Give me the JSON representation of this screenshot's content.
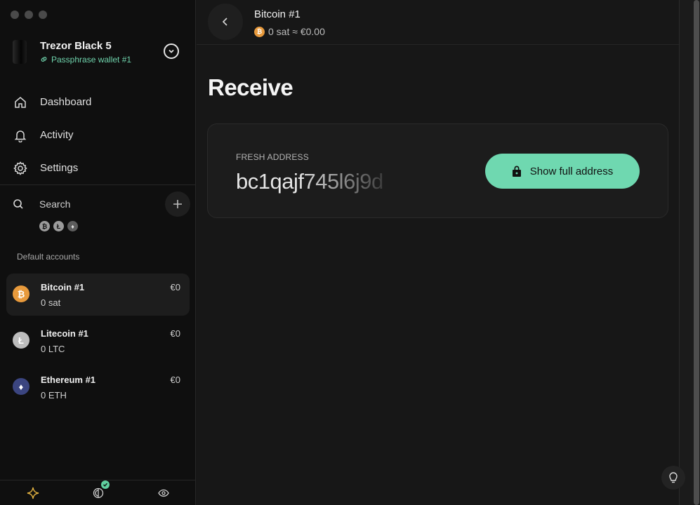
{
  "device": {
    "name": "Trezor Black 5",
    "subtitle": "Passphrase wallet #1"
  },
  "nav": {
    "items": [
      {
        "label": "Dashboard",
        "icon": "home-icon"
      },
      {
        "label": "Activity",
        "icon": "bell-icon"
      },
      {
        "label": "Settings",
        "icon": "gear-icon"
      }
    ]
  },
  "search": {
    "label": "Search"
  },
  "coin_filters": [
    "bitcoin-icon",
    "litecoin-icon",
    "ethereum-icon"
  ],
  "accounts_group": {
    "title": "Default accounts"
  },
  "accounts": [
    {
      "name": "Bitcoin #1",
      "balance": "0 sat",
      "fiat": "€0",
      "color": "#e89a3c",
      "symbol": "₿",
      "active": true
    },
    {
      "name": "Litecoin #1",
      "balance": "0 LTC",
      "fiat": "€0",
      "color": "#bdbdbd",
      "symbol": "Ł",
      "active": false
    },
    {
      "name": "Ethereum #1",
      "balance": "0 ETH",
      "fiat": "€0",
      "color": "#3b4580",
      "symbol": "♦",
      "active": false
    }
  ],
  "header": {
    "title": "Bitcoin #1",
    "subtitle": "0 sat ≈ €0.00"
  },
  "page": {
    "title": "Receive"
  },
  "receive": {
    "label": "FRESH ADDRESS",
    "address_partial": "bc1qajf745l6j9d",
    "button_label": "Show full address"
  },
  "colors": {
    "accent": "#6fd8b0",
    "bitcoin": "#e89a3c",
    "passphrase": "#6fd3ac"
  }
}
